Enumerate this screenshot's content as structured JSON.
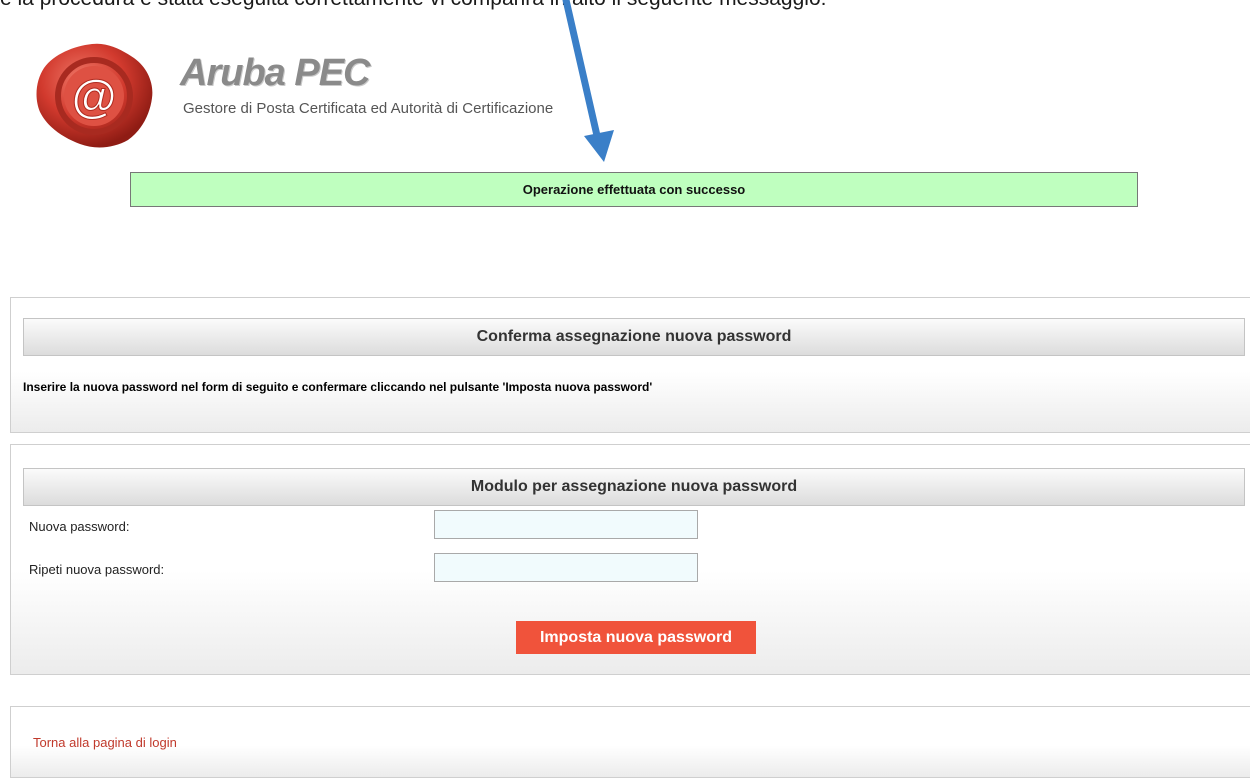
{
  "caption": "e la procedura è stata eseguita correttamente vi comparirà in alto il seguente messaggio:",
  "brand": {
    "name": "Aruba PEC",
    "tagline": "Gestore di Posta Certificata ed Autorità di Certificazione",
    "logo_icon": "at-wax-seal-icon"
  },
  "status_message": "Operazione effettuata con successo",
  "confirm_panel": {
    "title": "Conferma assegnazione nuova password",
    "instructions": "Inserire la nuova password nel form di seguito e confermare cliccando nel pulsante 'Imposta nuova password'"
  },
  "form_panel": {
    "title": "Modulo per assegnazione nuova password",
    "new_password_label": "Nuova password:",
    "repeat_password_label": "Ripeti nuova password:",
    "new_password_value": "",
    "repeat_password_value": "",
    "submit_label": "Imposta nuova password"
  },
  "footer": {
    "login_link": "Torna alla pagina di login"
  },
  "colors": {
    "success_bg": "#bfffbf",
    "button": "#f0533b",
    "link": "#c0392b",
    "arrow": "#3a7fc8",
    "seal": "#d23a2e"
  }
}
